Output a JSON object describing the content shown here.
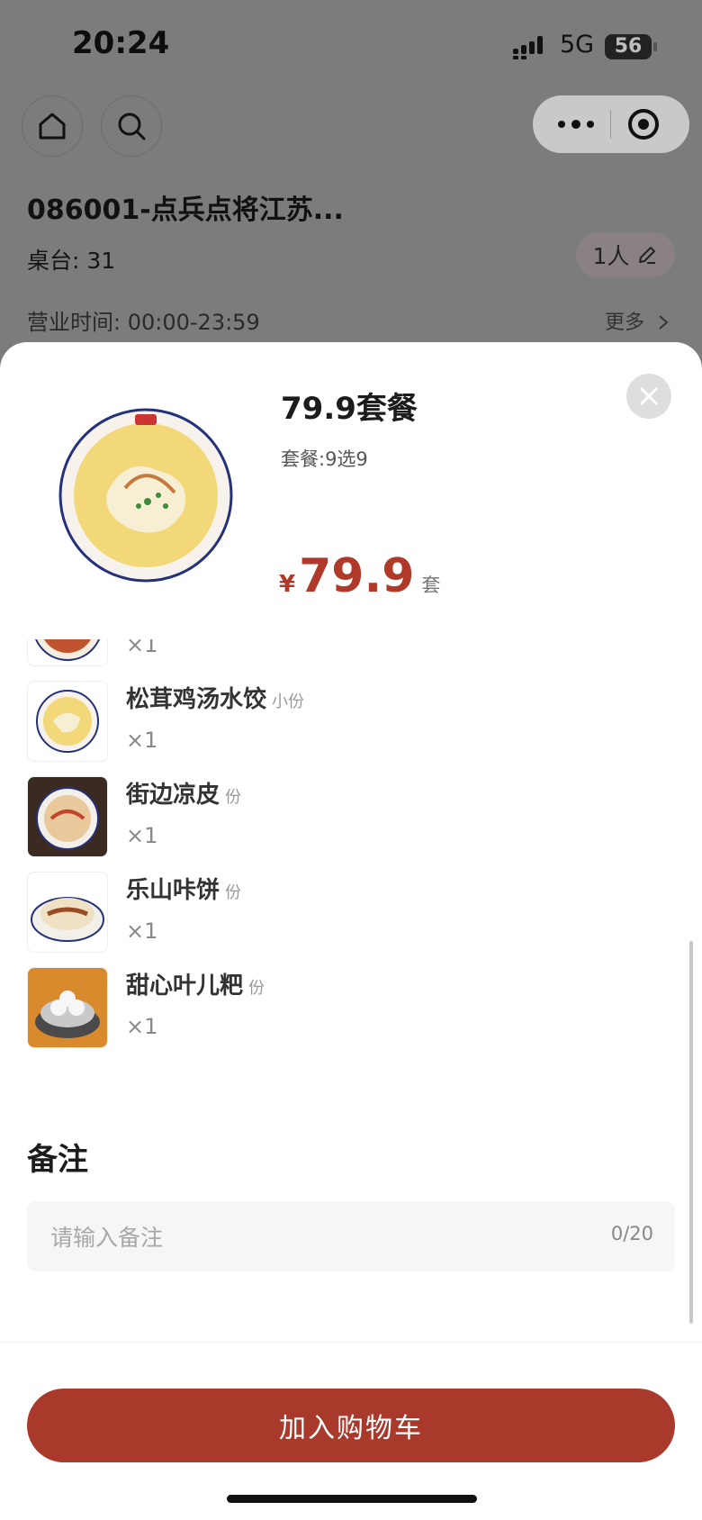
{
  "status_bar": {
    "time": "20:24",
    "network": "5G",
    "battery": "56"
  },
  "header": {
    "store_name": "086001-点兵点将江苏...",
    "table_label": "桌台:",
    "table_number": "31",
    "people": "1人",
    "hours_label": "营业时间:",
    "hours_value": "00:00-23:59",
    "more": "更多"
  },
  "product": {
    "name": "79.9套餐",
    "subtitle": "套餐:9选9",
    "currency": "¥",
    "price": "79.9",
    "unit": "套"
  },
  "items": [
    {
      "name": "",
      "unit": "",
      "qty": "×1"
    },
    {
      "name": "松茸鸡汤水饺",
      "unit": "小份",
      "qty": "×1"
    },
    {
      "name": "街边凉皮",
      "unit": "份",
      "qty": "×1"
    },
    {
      "name": "乐山咔饼",
      "unit": "份",
      "qty": "×1"
    },
    {
      "name": "甜心叶儿粑",
      "unit": "份",
      "qty": "×1"
    }
  ],
  "remark": {
    "title": "备注",
    "placeholder": "请输入备注",
    "count": "0/20"
  },
  "footer": {
    "add_to_cart": "加入购物车"
  },
  "colors": {
    "accent": "#a93a2b",
    "price": "#b0392a",
    "overlay": "#7c7c7c"
  },
  "icons": [
    "home-icon",
    "search-icon",
    "more-dots-icon",
    "target-icon",
    "edit-pencil-icon",
    "chevron-right-icon",
    "close-icon"
  ]
}
